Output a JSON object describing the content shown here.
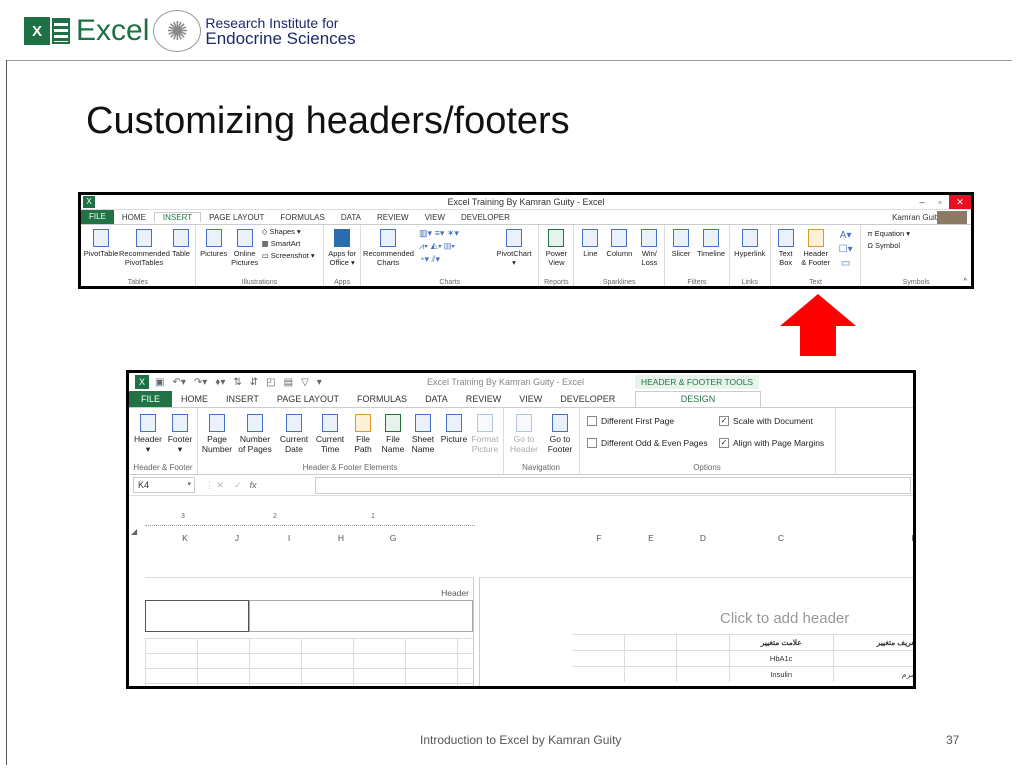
{
  "slide": {
    "logo": {
      "excel_text": "Excel",
      "institute_line1": "Research Institute for",
      "institute_line2": "Endocrine Sciences"
    },
    "title": "Customizing headers/footers",
    "footer": "Introduction to Excel by Kamran Guity",
    "page_number": "37",
    "colors": {
      "excel_green": "#1e7145",
      "arrow_red": "#ff0000",
      "close_red": "#e81123"
    }
  },
  "ribbon1": {
    "window_title": "Excel Training By Kamran Guity - Excel",
    "user": "Kamran Guity",
    "tabs": [
      "FILE",
      "HOME",
      "INSERT",
      "PAGE LAYOUT",
      "FORMULAS",
      "DATA",
      "REVIEW",
      "VIEW",
      "DEVELOPER"
    ],
    "active_tab": "INSERT",
    "groups": {
      "tables": {
        "name": "Tables",
        "pivot": "PivotTable",
        "rec_pivot_1": "Recommended",
        "rec_pivot_2": "PivotTables",
        "table": "Table"
      },
      "illustrations": {
        "name": "Illustrations",
        "pictures": "Pictures",
        "online_1": "Online",
        "online_2": "Pictures",
        "shapes": "Shapes",
        "smartart": "SmartArt",
        "screenshot": "Screenshot"
      },
      "apps": {
        "name": "Apps",
        "label_1": "Apps for",
        "label_2": "Office"
      },
      "charts": {
        "name": "Charts",
        "rec_1": "Recommended",
        "rec_2": "Charts",
        "pivotchart": "PivotChart"
      },
      "reports": {
        "name": "Reports",
        "power_1": "Power",
        "power_2": "View"
      },
      "sparklines": {
        "name": "Sparklines",
        "line": "Line",
        "column": "Column",
        "winloss_1": "Win/",
        "winloss_2": "Loss"
      },
      "filters": {
        "name": "Filters",
        "slicer": "Slicer",
        "timeline": "Timeline"
      },
      "links": {
        "name": "Links",
        "hyperlink": "Hyperlink"
      },
      "text": {
        "name": "Text",
        "textbox_1": "Text",
        "textbox_2": "Box",
        "hf_1": "Header",
        "hf_2": "& Footer"
      },
      "symbols": {
        "name": "Symbols",
        "equation": "Equation",
        "symbol": "Symbol"
      }
    }
  },
  "ribbon2": {
    "window_title": "Excel Training By Kamran Guity - Excel",
    "context_tab": "HEADER & FOOTER TOOLS",
    "tabs": [
      "FILE",
      "HOME",
      "INSERT",
      "PAGE LAYOUT",
      "FORMULAS",
      "DATA",
      "REVIEW",
      "VIEW",
      "DEVELOPER"
    ],
    "design_tab": "DESIGN",
    "groups": {
      "hf": {
        "name": "Header & Footer",
        "header": "Header",
        "footer": "Footer"
      },
      "elements": {
        "name": "Header & Footer Elements",
        "page_number_1": "Page",
        "page_number_2": "Number",
        "num_pages_1": "Number",
        "num_pages_2": "of Pages",
        "cur_date_1": "Current",
        "cur_date_2": "Date",
        "cur_time_1": "Current",
        "cur_time_2": "Time",
        "file_path_1": "File",
        "file_path_2": "Path",
        "file_name_1": "File",
        "file_name_2": "Name",
        "sheet_name_1": "Sheet",
        "sheet_name_2": "Name",
        "picture": "Picture",
        "format_pic_1": "Format",
        "format_pic_2": "Picture"
      },
      "navigation": {
        "name": "Navigation",
        "goto_header_1": "Go to",
        "goto_header_2": "Header",
        "goto_footer_1": "Go to",
        "goto_footer_2": "Footer"
      },
      "options": {
        "name": "Options",
        "diff_first": "Different First Page",
        "diff_odd_even": "Different Odd & Even Pages",
        "scale_doc": "Scale with Document",
        "align_margins": "Align with Page Margins"
      }
    },
    "name_box": "K4",
    "fx": "fx",
    "ruler_marks": [
      "3",
      "2",
      "1"
    ],
    "columns_left": [
      "K",
      "J",
      "I",
      "H",
      "G"
    ],
    "columns_right": [
      "F",
      "E",
      "D",
      "C",
      "B"
    ],
    "header_label": "Header",
    "click_to_add": "Click to add header",
    "table_rows": [
      {
        "c": "علامت متغییر",
        "b": "تعریف متغییر"
      },
      {
        "c": "HbA1c",
        "b": ""
      },
      {
        "c": "Insulin",
        "b": "سرم"
      }
    ]
  }
}
